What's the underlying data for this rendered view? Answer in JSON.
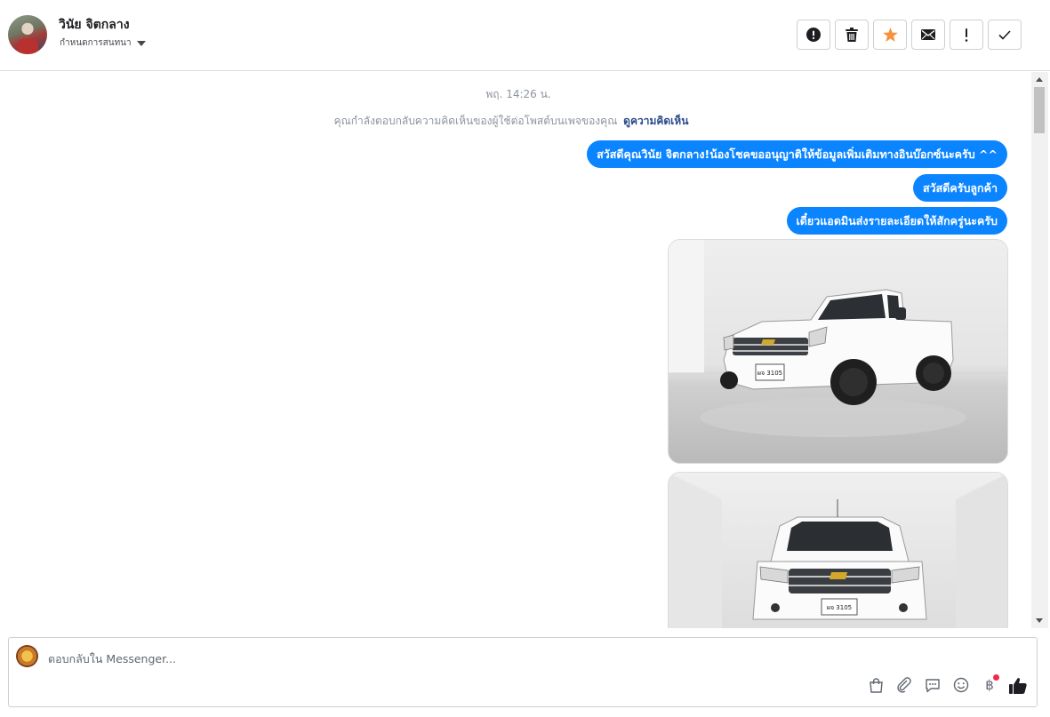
{
  "header": {
    "contact_name": "วินัย จิตกลาง",
    "assign_label": "กำหนดการสนทนา",
    "toolbar": [
      {
        "name": "report-spam-button",
        "icon": "alert-circle-icon"
      },
      {
        "name": "delete-button",
        "icon": "trash-icon"
      },
      {
        "name": "star-button",
        "icon": "star-icon",
        "color": "#f7923b"
      },
      {
        "name": "mark-unread-button",
        "icon": "envelope-icon"
      },
      {
        "name": "follow-up-button",
        "icon": "exclamation-icon"
      },
      {
        "name": "mark-done-button",
        "icon": "checkmark-icon"
      }
    ]
  },
  "thread": {
    "timestamp": "พฤ. 14:26 น.",
    "notice_text": "คุณกำลังตอบกลับความคิดเห็นของผู้ใช้ต่อโพสต์บนเพจของคุณ",
    "notice_link": "ดูความคิดเห็น",
    "messages": [
      {
        "text": "สวัสดีคุณวินัย จิตกลาง!น้องโชคขออนุญาติให้ข้อมูลเพิ่มเติมทางอินบ๊อกซ์นะครับ ^^"
      },
      {
        "text": "สวัสดีครับลูกค้า"
      },
      {
        "text": "เดี๋ยวแอดมินส่งรายละเอียดให้สักครู่นะครับ"
      }
    ],
    "photos": [
      {
        "subject": "white pickup truck three-quarter view",
        "plate": "ผจ 3105"
      },
      {
        "subject": "white pickup truck front view",
        "plate": "ผจ 3105"
      }
    ],
    "bubble_color": "#0a84ff"
  },
  "composer": {
    "placeholder": "ตอบกลับใน Messenger...",
    "tools": [
      "shopping-bag-icon",
      "paperclip-icon",
      "saved-reply-icon",
      "emoji-icon",
      "baht-payment-icon",
      "thumbs-up-icon"
    ],
    "baht_symbol": "฿"
  }
}
